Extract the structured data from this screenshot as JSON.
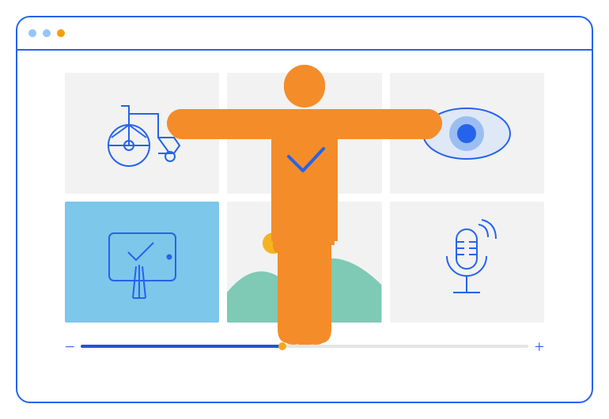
{
  "window": {
    "dots": [
      "blue",
      "blue",
      "orange"
    ]
  },
  "tiles": [
    {
      "name": "wheelchair-icon",
      "bg": "gray"
    },
    {
      "name": "blank-tile",
      "bg": "gray"
    },
    {
      "name": "eye-icon",
      "bg": "gray"
    },
    {
      "name": "touch-tablet-icon",
      "bg": "blue"
    },
    {
      "name": "landscape-sun-tile",
      "bg": "gray"
    },
    {
      "name": "microphone-icon",
      "bg": "gray"
    }
  ],
  "slider": {
    "minus": "−",
    "plus": "+",
    "percent": 45
  },
  "colors": {
    "brand_blue": "#2563eb",
    "accent_orange": "#f5a623",
    "figure_orange": "#f48c2a",
    "teal": "#7ecab4",
    "tile_blue": "#7cc7ea",
    "tile_gray": "#f2f2f2"
  }
}
